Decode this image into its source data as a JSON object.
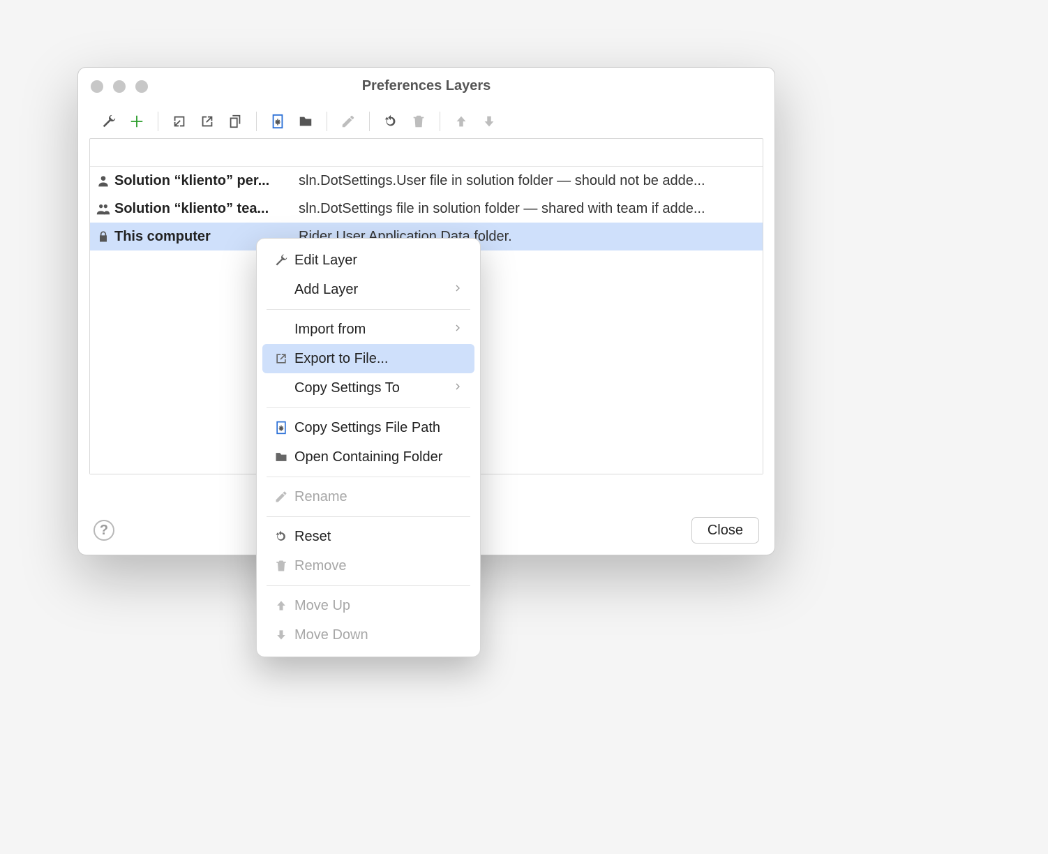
{
  "window": {
    "title": "Preferences Layers",
    "close_label": "Close",
    "help_label": "?"
  },
  "toolbar": {
    "edit": "Edit Layer",
    "add": "Add Layer",
    "import": "Import",
    "export": "Export",
    "copy_settings": "Copy Settings",
    "copy_path": "Copy Settings File Path",
    "open_folder": "Open Containing Folder",
    "rename": "Rename",
    "reset": "Reset",
    "remove": "Remove",
    "move_up": "Move Up",
    "move_down": "Move Down"
  },
  "layers": [
    {
      "icon": "person-icon",
      "name": "Solution “kliento” per...",
      "description": "sln.DotSettings.User file in solution folder — should not be adde..."
    },
    {
      "icon": "team-icon",
      "name": "Solution “kliento” tea...",
      "description": "sln.DotSettings file in solution folder — shared with team if adde..."
    },
    {
      "icon": "lock-icon",
      "name": "This computer",
      "description": "Rider User Application Data folder."
    }
  ],
  "context_menu": {
    "groups": [
      [
        {
          "icon": "wrench-icon",
          "label": "Edit Layer",
          "submenu": false,
          "enabled": true
        },
        {
          "icon": "",
          "label": "Add Layer",
          "submenu": true,
          "enabled": true
        }
      ],
      [
        {
          "icon": "",
          "label": "Import from",
          "submenu": true,
          "enabled": true
        },
        {
          "icon": "export-icon",
          "label": "Export to File...",
          "submenu": false,
          "enabled": true,
          "highlight": true
        },
        {
          "icon": "",
          "label": "Copy Settings To",
          "submenu": true,
          "enabled": true
        }
      ],
      [
        {
          "icon": "file-settings-icon",
          "label": "Copy Settings File Path",
          "submenu": false,
          "enabled": true
        },
        {
          "icon": "folder-icon",
          "label": "Open Containing Folder",
          "submenu": false,
          "enabled": true
        }
      ],
      [
        {
          "icon": "pencil-icon",
          "label": "Rename",
          "submenu": false,
          "enabled": false
        }
      ],
      [
        {
          "icon": "reset-icon",
          "label": "Reset",
          "submenu": false,
          "enabled": true
        },
        {
          "icon": "trash-icon",
          "label": "Remove",
          "submenu": false,
          "enabled": false
        }
      ],
      [
        {
          "icon": "arrow-up-icon",
          "label": "Move Up",
          "submenu": false,
          "enabled": false
        },
        {
          "icon": "arrow-down-icon",
          "label": "Move Down",
          "submenu": false,
          "enabled": false
        }
      ]
    ]
  }
}
